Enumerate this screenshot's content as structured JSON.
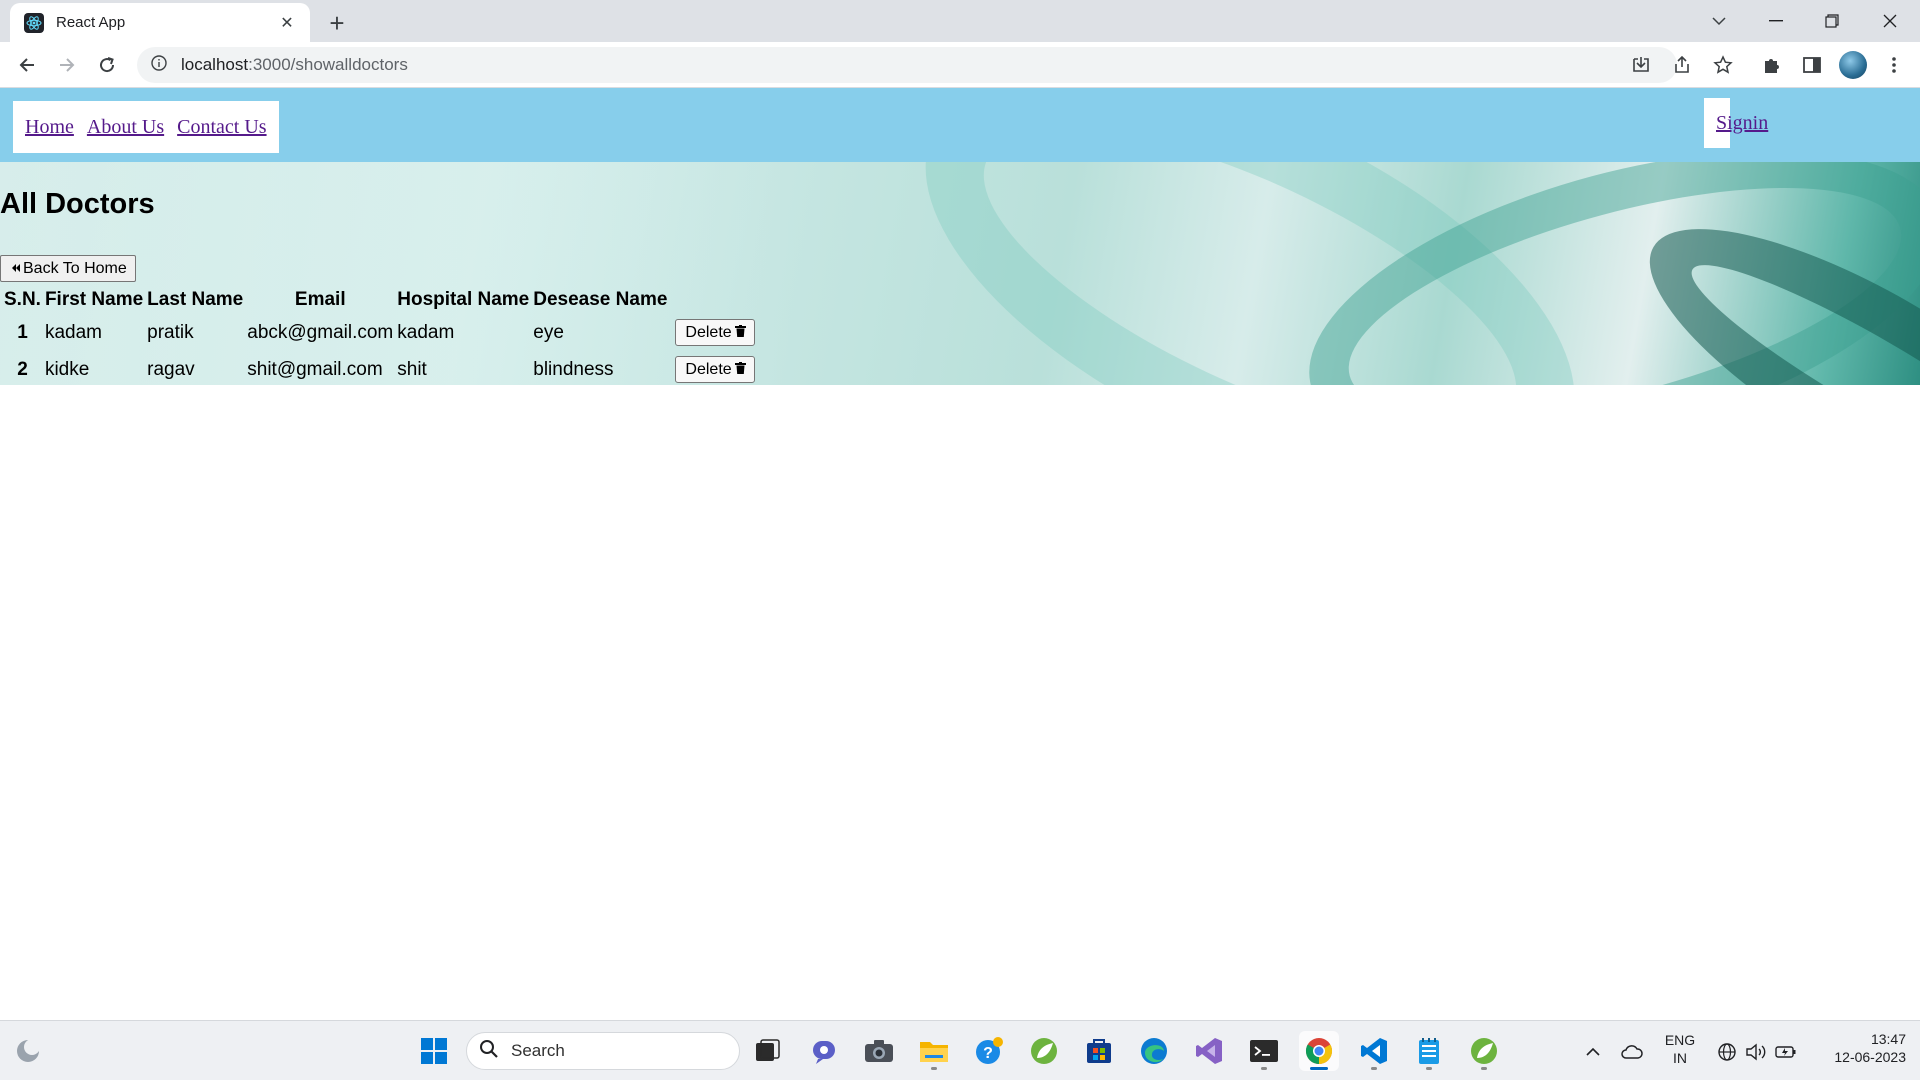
{
  "browser": {
    "tab_title": "React App",
    "url_host": "localhost",
    "url_rest": ":3000/showalldoctors"
  },
  "navbar": {
    "links": [
      "Home",
      "About Us",
      "Contact Us"
    ],
    "signin": "Signin"
  },
  "main": {
    "title": "All Doctors",
    "back_button": "Back To Home"
  },
  "table": {
    "headers": [
      "S.N.",
      "First Name",
      "Last Name",
      "Email",
      "Hospital Name",
      "Desease Name"
    ],
    "rows": [
      {
        "sn": "1",
        "first": "kadam",
        "last": "pratik",
        "email": "abck@gmail.com",
        "hospital": "kadam",
        "disease": "eye",
        "action": "Delete"
      },
      {
        "sn": "2",
        "first": "kidke",
        "last": "ragav",
        "email": "shit@gmail.com",
        "hospital": "shit",
        "disease": "blindness",
        "action": "Delete"
      }
    ]
  },
  "taskbar": {
    "search_placeholder": "Search",
    "lang_top": "ENG",
    "lang_bottom": "IN",
    "time": "13:47",
    "date": "12-06-2023"
  },
  "colors": {
    "navbar_bg": "#87ceeb",
    "link": "#551a8b"
  }
}
